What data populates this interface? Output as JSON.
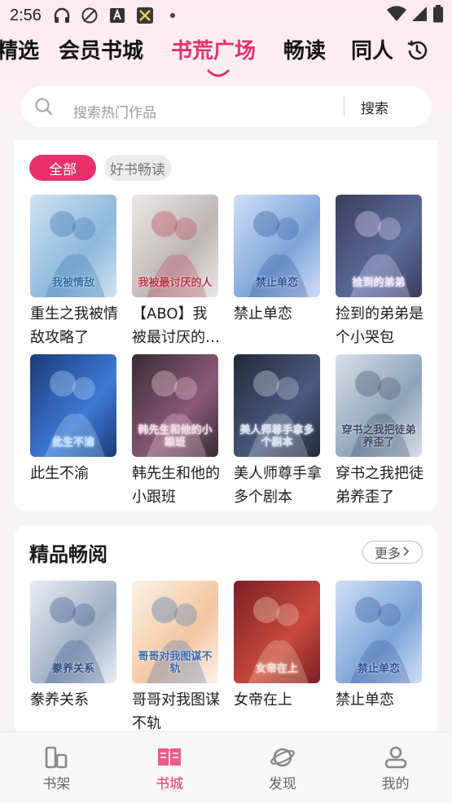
{
  "status_bar": {
    "time": "2:56"
  },
  "top_tabs": [
    "精选",
    "会员书城",
    "书荒广场",
    "畅读",
    "同人"
  ],
  "active_tab_index": 2,
  "search": {
    "placeholder": "搜索热门作品",
    "button_label": "搜索"
  },
  "filter_chips": [
    {
      "label": "全部",
      "active": true
    },
    {
      "label": "好书畅读",
      "active": false
    }
  ],
  "books_grid": [
    {
      "title": "重生之我被情敌攻略了",
      "cover_text": "我被情敌",
      "palette": [
        "#cfe3f3",
        "#8fb8da",
        "#2f6ea8"
      ]
    },
    {
      "title": "【ABO】我被最讨厌的人...",
      "cover_text": "我被最讨厌的人",
      "palette": [
        "#ece8e8",
        "#bfb6b6",
        "#b83a4a"
      ]
    },
    {
      "title": "禁止单恋",
      "cover_text": "禁止单恋",
      "palette": [
        "#cfe0f6",
        "#7fa4d8",
        "#2f4f9a"
      ]
    },
    {
      "title": "捡到的弟弟是个小哭包",
      "cover_text": "捡到的弟弟",
      "palette": [
        "#3b3e5c",
        "#5a6c9a",
        "#f1e6ff"
      ]
    },
    {
      "title": "此生不渝",
      "cover_text": "此生不渝",
      "palette": [
        "#1b3a7a",
        "#3e7ad4",
        "#bfe3ff"
      ]
    },
    {
      "title": "韩先生和他的小跟班",
      "cover_text": "韩先生和他的小跟班",
      "palette": [
        "#3a2a36",
        "#8a5a78",
        "#f6d6e6"
      ]
    },
    {
      "title": "美人师尊手拿多个剧本",
      "cover_text": "美人师尊手拿多个剧本",
      "palette": [
        "#222a3a",
        "#4a5a7e",
        "#d9e2f2"
      ]
    },
    {
      "title": "穿书之我把徒弟养歪了",
      "cover_text": "穿书之我把徒弟养歪了",
      "palette": [
        "#d6e0ea",
        "#8ea4bc",
        "#3a4a66"
      ]
    }
  ],
  "premium_section": {
    "title": "精品畅阅",
    "more_label": "更多",
    "books": [
      {
        "title": "豢养关系",
        "cover_text": "豢养关系",
        "palette": [
          "#e9eef5",
          "#9eb0c6",
          "#2c4a7a"
        ]
      },
      {
        "title": "哥哥对我图谋不轨",
        "cover_text": "哥哥对我图谋不轨",
        "palette": [
          "#fdf3e6",
          "#f2c6a0",
          "#3c6ab2"
        ]
      },
      {
        "title": "女帝在上",
        "cover_text": "女帝在上",
        "palette": [
          "#7a1e24",
          "#c94a3e",
          "#f6dcc6"
        ]
      },
      {
        "title": "禁止单恋",
        "cover_text": "禁止单恋",
        "palette": [
          "#cfe0f6",
          "#7fa4d8",
          "#2f4f9a"
        ]
      }
    ]
  },
  "bottom_nav": [
    {
      "label": "书架",
      "icon": "bookshelf-icon",
      "active": false
    },
    {
      "label": "书城",
      "icon": "book-open-icon",
      "active": true
    },
    {
      "label": "发现",
      "icon": "discover-planet-icon",
      "active": false
    },
    {
      "label": "我的",
      "icon": "profile-icon",
      "active": false
    }
  ],
  "colors": {
    "accent": "#e8306d",
    "chip_inactive_bg": "#ececec",
    "background": "#f6f4f5"
  }
}
